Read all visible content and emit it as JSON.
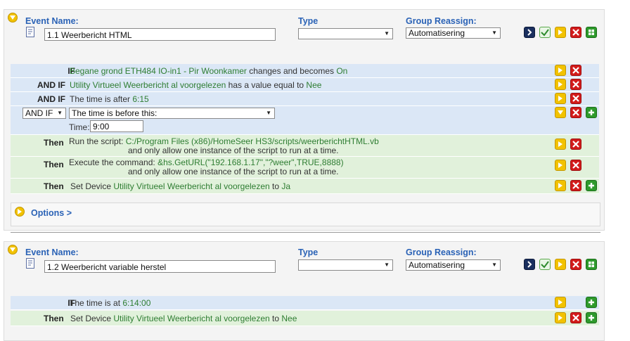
{
  "events": [
    {
      "name_label": "Event Name:",
      "name_value": "1.1 Weerbericht HTML",
      "type_label": "Type",
      "type_value": "",
      "group_label": "Group Reassign:",
      "group_value": "Automatisering",
      "conditions": [
        {
          "keyword": "IF",
          "text1": "Begane grond ETH484 IO-in1 - Pir Woonkamer",
          "text2": " changes and becomes ",
          "text3": "On"
        },
        {
          "keyword": "AND IF",
          "text1": "Utility Virtueel Weerbericht al voorgelezen",
          "text2": " has a value equal to ",
          "text3": "Nee"
        },
        {
          "keyword": "AND IF",
          "text1": "The time is after ",
          "text2": "6:15"
        }
      ],
      "edit_row": {
        "logic_value": "AND IF",
        "condition_value": "The time is before this:",
        "time_label": "Time:",
        "time_value": "9:00"
      },
      "actions": [
        {
          "keyword": "Then",
          "line1a": "Run the script: ",
          "line1b": "C:/Program Files (x86)/HomeSeer HS3/scripts/weerberichtHTML.vb",
          "line2": "and only allow one instance of the script to run at a time."
        },
        {
          "keyword": "Then",
          "line1a": "Execute the command: ",
          "line1b": "&hs.GetURL(\"192.168.1.17\",\"?weer\",TRUE,8888)",
          "line2": "and only allow one instance of the script to run at a time."
        },
        {
          "keyword": "Then",
          "line1a": "Set Device ",
          "line1b": "Utility Virtueel Weerbericht al voorgelezen",
          "line1c": " to ",
          "line1d": "Ja"
        }
      ],
      "options_label": "Options >"
    },
    {
      "name_label": "Event Name:",
      "name_value": "1.2 Weerbericht variable herstel",
      "type_label": "Type",
      "type_value": "",
      "group_label": "Group Reassign:",
      "group_value": "Automatisering",
      "conditions": [
        {
          "keyword": "IF",
          "text1": "The time is at ",
          "text2": "6:14:00"
        }
      ],
      "actions": [
        {
          "keyword": "Then",
          "line1a": "Set Device ",
          "line1b": "Utility Virtueel Weerbericht al voorgelezen",
          "line1c": " to ",
          "line1d": "Nee"
        }
      ]
    }
  ],
  "icons": {
    "run": "run-icon",
    "enable": "check-icon",
    "edit": "edit-icon",
    "delete": "delete-icon",
    "add": "add-icon",
    "collapse": "chevron-down-icon",
    "options": "chevron-right-icon"
  },
  "colors": {
    "label_blue": "#2a62b6",
    "value_green": "#2e7d32",
    "condition_row": "#dbe7f6",
    "action_row": "#e1f1db"
  }
}
